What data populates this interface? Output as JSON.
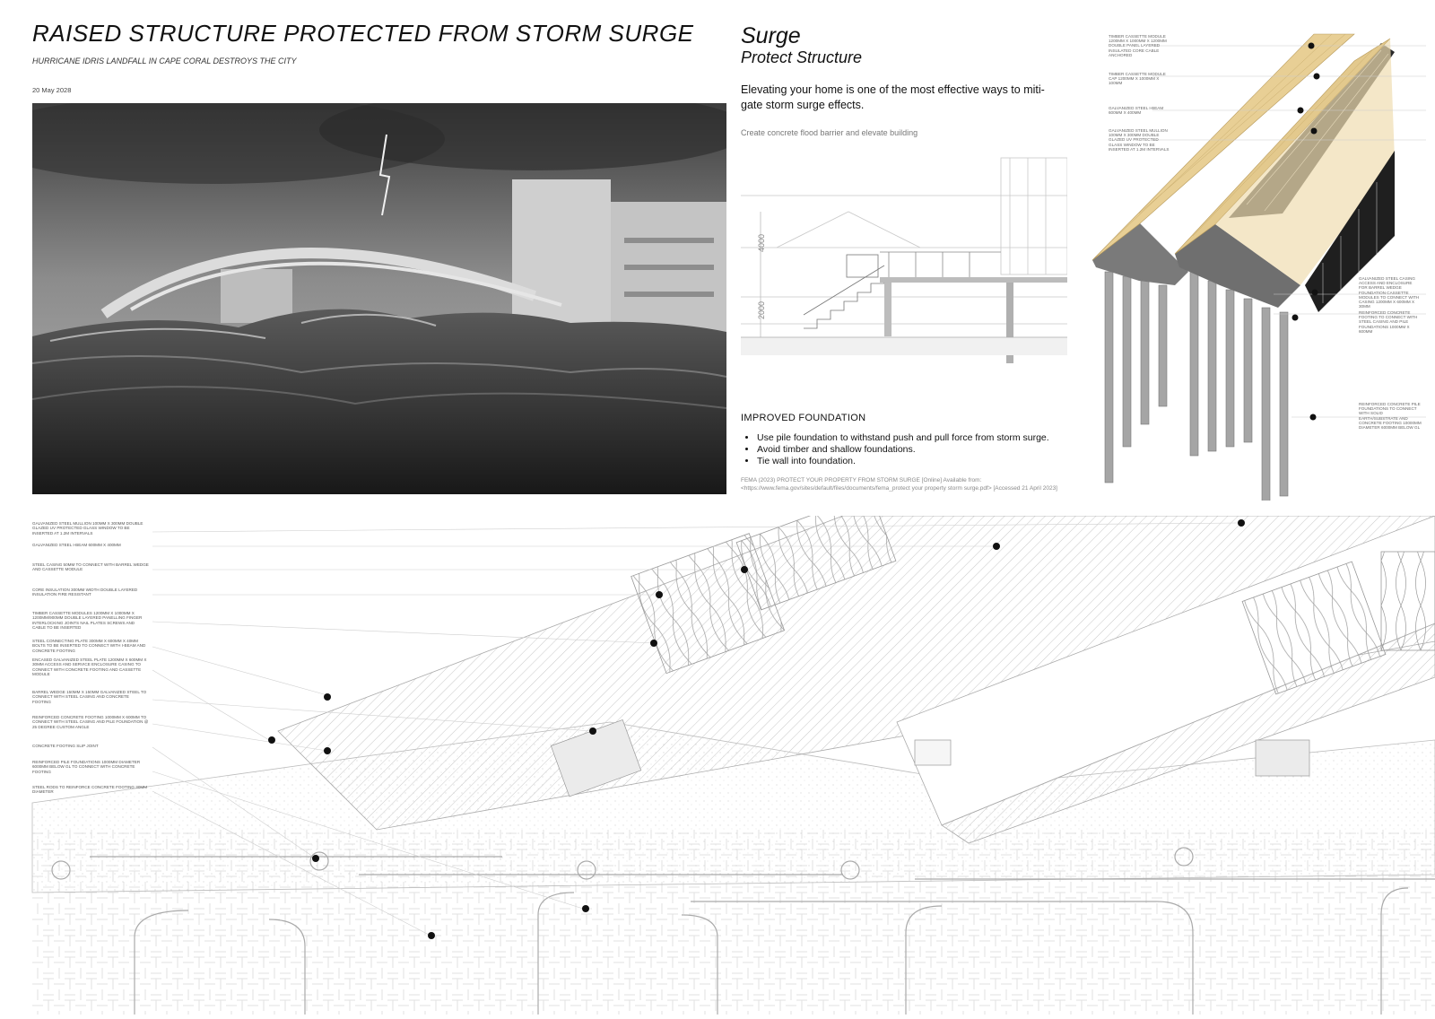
{
  "header": {
    "title": "RAISED STRUCTURE PROTECTED FROM STORM SURGE",
    "subtitle": "HURRICANE IDRIS LANDFALL IN CAPE CORAL DESTROYS THE CITY",
    "date": "20 May 2028"
  },
  "info": {
    "heading": "Surge",
    "subheading": "Protect Structure",
    "lead": "Elevating your home is one of the most effective ways to miti-gate storm surge effects.",
    "note": "Create concrete flood barrier and elevate building",
    "section_dims": [
      "4000",
      "2000"
    ],
    "foundation_heading": "IMPROVED FOUNDATION",
    "foundation_items": [
      "Use pile foundation to withstand push and pull force from storm surge.",
      "Avoid timber and shallow foundations.",
      "Tie wall into foundation."
    ],
    "reference": "FEMA (2023) PROTECT YOUR PROPERTY FROM STORM SURGE [Online] Available from: <https://www.fema.gov/sites/default/files/documents/fema_protect your property storm surge.pdf> [Accessed 21 April 2023]"
  },
  "iso_labels": [
    "TIMBER CASSETTE MODULE 1200MM X 1000MM X 1200MM DOUBLE PANEL LAYERED INSULATED CORE CABLE ANCHORED",
    "TIMBER CASSETTE MODULE CAP 1200MM X 1000MM X 100MM",
    "GALVANIZED STEEL I-BEAM 600MM X 400MM",
    "GALVANIZED STEEL MULLION 100MM X 300MM DOUBLE GLAZED UV PROTECTED GLASS WINDOW TO BE INSERTED AT 1.2M INTERVALS",
    "GALVANIZED STEEL CASING ACCESS AND ENCLOSURE FOR BARREL WEDGE FOUNDATION CASSETTE MODULES TO CONNECT WITH CASING 1200MM X 600MM X 30MM",
    "REINFORCED CONCRETE FOOTING TO CONNECT WITH STEEL CASING AND PILE FOUNDATIONS 1000MM X 600MM",
    "REINFORCED CONCRETE PILE FOUNDATIONS TO CONNECT WITH SOLID EARTH/SUBSTRATE AND CONCRETE FOOTING 10000MM DIAMETER 6000MM BELOW GL"
  ],
  "detail_labels": [
    "GALVANIZED STEEL MULLION 100MM X 300MM DOUBLE GLAZED UV PROTECTED GLASS WINDOW TO BE INSERTED AT 1.2M INTERVALS",
    "GALVANIZED STEEL I-BEAM 600MM X 400MM",
    "STEEL CASING 50MM TO CONNECT WITH BARREL WEDGE AND CASSETTE MODULE",
    "CORE INSULATION 300MM WIDTH DOUBLE LAYERED INSULATION FIRE RESISTANT",
    "TIMBER CASSETTE MODULES 1200MM X 1000MM X 1200MM/900MM DOUBLE LAYERED PANELLING FINGER INTERLOCKING JOINTS NAIL PLATES SCREWS AND CABLE TO BE INSERTED",
    "STEEL CONNECTING PLATE 300MM X 600MM X 40MM BOLTS TO BE INSERTED TO CONNECT WITH I-BEAM AND CONCRETE FOOTING",
    "ENCASED GALVANIZED STEEL PLATE 1200MM X 600MM X 30MM ACCESS AND SERVICE ENCLOSURE CASING TO CONNECT WITH CONCRETE FOOTING AND CASSETTE MODULE",
    "BARREL WEDGE 150MM X 150MM GALVANIZED STEEL TO CONNECT WITH STEEL CASING AND CONCRETE FOOTING",
    "REINFORCED CONCRETE FOOTING 1000MM X 600MM TO CONNECT WITH STEEL CASING AND PILE FOUNDATION @ 25 DEGREE CUSTOM ANGLE",
    "CONCRETE FOOTING SLIP JOINT",
    "REINFORCED PILE FOUNDATIONS 1000MM DIAMETER 6000MM BELOW GL TO CONNECT WITH CONCRETE FOOTING",
    "STEEL RODS TO REINFORCE CONCRETE FOOTING 30MM DIAMETER"
  ],
  "colors": {
    "timber": "#e8cf95",
    "concrete": "#8a8a8a",
    "pile": "#a2a2a2",
    "line": "#b5b5b5"
  }
}
